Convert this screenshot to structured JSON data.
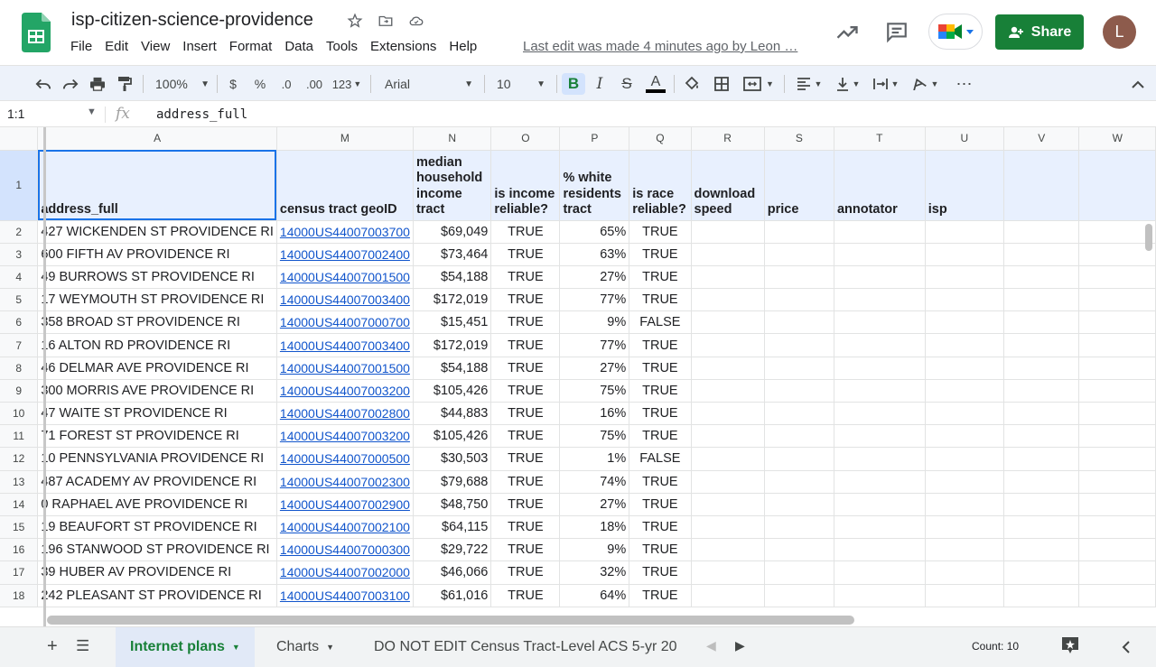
{
  "doc": {
    "title": "isp-citizen-science-providence",
    "last_edit": "Last edit was made 4 minutes ago by Leon …"
  },
  "menu": [
    "File",
    "Edit",
    "View",
    "Insert",
    "Format",
    "Data",
    "Tools",
    "Extensions",
    "Help"
  ],
  "share_label": "Share",
  "avatar_initial": "L",
  "toolbar": {
    "zoom": "100%",
    "currency": "$",
    "percent": "%",
    "dec_decrease": ".0",
    "dec_increase": ".00",
    "more_formats": "123",
    "font": "Arial",
    "font_size": "10",
    "bold": "B",
    "italic": "I",
    "strike": "S",
    "text_color": "A"
  },
  "formula_bar": {
    "namebox": "1:1",
    "fx": "fx",
    "value": "address_full"
  },
  "columns": [
    "A",
    "M",
    "N",
    "O",
    "P",
    "Q",
    "R",
    "S",
    "T",
    "U",
    "V",
    "W"
  ],
  "header_row": {
    "num": "1",
    "cells": [
      "address_full",
      "census tract geoID",
      "median household income tract",
      "is income reliable?",
      "% white residents tract",
      "is race reliable?",
      "download speed",
      "price",
      "annotator",
      "isp",
      "",
      ""
    ]
  },
  "rows": [
    {
      "num": "2",
      "address": "427 WICKENDEN ST PROVIDENCE RI",
      "geoid": "14000US44007003700",
      "income": "$69,049",
      "inc_rel": "TRUE",
      "white": "65%",
      "race_rel": "TRUE"
    },
    {
      "num": "3",
      "address": "600 FIFTH AV PROVIDENCE RI",
      "geoid": "14000US44007002400",
      "income": "$73,464",
      "inc_rel": "TRUE",
      "white": "63%",
      "race_rel": "TRUE"
    },
    {
      "num": "4",
      "address": "49 BURROWS ST PROVIDENCE RI",
      "geoid": "14000US44007001500",
      "income": "$54,188",
      "inc_rel": "TRUE",
      "white": "27%",
      "race_rel": "TRUE"
    },
    {
      "num": "5",
      "address": "17 WEYMOUTH ST PROVIDENCE RI",
      "geoid": "14000US44007003400",
      "income": "$172,019",
      "inc_rel": "TRUE",
      "white": "77%",
      "race_rel": "TRUE"
    },
    {
      "num": "6",
      "address": "358 BROAD ST PROVIDENCE RI",
      "geoid": "14000US44007000700",
      "income": "$15,451",
      "inc_rel": "TRUE",
      "white": "9%",
      "race_rel": "FALSE"
    },
    {
      "num": "7",
      "address": "16 ALTON RD PROVIDENCE RI",
      "geoid": "14000US44007003400",
      "income": "$172,019",
      "inc_rel": "TRUE",
      "white": "77%",
      "race_rel": "TRUE"
    },
    {
      "num": "8",
      "address": "46 DELMAR AVE PROVIDENCE RI",
      "geoid": "14000US44007001500",
      "income": "$54,188",
      "inc_rel": "TRUE",
      "white": "27%",
      "race_rel": "TRUE"
    },
    {
      "num": "9",
      "address": "300 MORRIS AVE PROVIDENCE RI",
      "geoid": "14000US44007003200",
      "income": "$105,426",
      "inc_rel": "TRUE",
      "white": "75%",
      "race_rel": "TRUE"
    },
    {
      "num": "10",
      "address": "47 WAITE ST PROVIDENCE RI",
      "geoid": "14000US44007002800",
      "income": "$44,883",
      "inc_rel": "TRUE",
      "white": "16%",
      "race_rel": "TRUE"
    },
    {
      "num": "11",
      "address": "71 FOREST ST PROVIDENCE RI",
      "geoid": "14000US44007003200",
      "income": "$105,426",
      "inc_rel": "TRUE",
      "white": "75%",
      "race_rel": "TRUE"
    },
    {
      "num": "12",
      "address": "10 PENNSYLVANIA PROVIDENCE RI",
      "geoid": "14000US44007000500",
      "income": "$30,503",
      "inc_rel": "TRUE",
      "white": "1%",
      "race_rel": "FALSE"
    },
    {
      "num": "13",
      "address": "487 ACADEMY AV PROVIDENCE RI",
      "geoid": "14000US44007002300",
      "income": "$79,688",
      "inc_rel": "TRUE",
      "white": "74%",
      "race_rel": "TRUE"
    },
    {
      "num": "14",
      "address": "0 RAPHAEL AVE PROVIDENCE RI",
      "geoid": "14000US44007002900",
      "income": "$48,750",
      "inc_rel": "TRUE",
      "white": "27%",
      "race_rel": "TRUE"
    },
    {
      "num": "15",
      "address": "19 BEAUFORT ST PROVIDENCE RI",
      "geoid": "14000US44007002100",
      "income": "$64,115",
      "inc_rel": "TRUE",
      "white": "18%",
      "race_rel": "TRUE"
    },
    {
      "num": "16",
      "address": "196 STANWOOD ST PROVIDENCE RI",
      "geoid": "14000US44007000300",
      "income": "$29,722",
      "inc_rel": "TRUE",
      "white": "9%",
      "race_rel": "TRUE"
    },
    {
      "num": "17",
      "address": "39 HUBER AV PROVIDENCE RI",
      "geoid": "14000US44007002000",
      "income": "$46,066",
      "inc_rel": "TRUE",
      "white": "32%",
      "race_rel": "TRUE"
    },
    {
      "num": "18",
      "address": "242 PLEASANT ST PROVIDENCE RI",
      "geoid": "14000US44007003100",
      "income": "$61,016",
      "inc_rel": "TRUE",
      "white": "64%",
      "race_rel": "TRUE"
    }
  ],
  "sheets": [
    {
      "label": "Internet plans",
      "active": true
    },
    {
      "label": "Charts",
      "active": false
    },
    {
      "label": "DO NOT EDIT Census Tract-Level ACS 5-yr 20",
      "active": false
    }
  ],
  "status": {
    "count": "Count: 10"
  },
  "colors": {
    "accent": "#188038",
    "selection": "#1a73e8",
    "link": "#1155cc"
  }
}
